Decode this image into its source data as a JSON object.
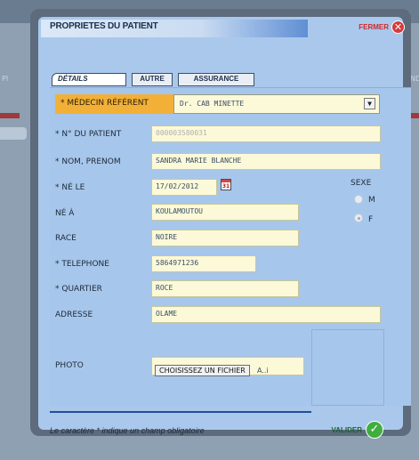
{
  "background": {
    "left_edge_text": "PI",
    "right_edge_text": "ND"
  },
  "modal": {
    "title": "PROPRIETES DU PATIENT",
    "close_label": "FERMER",
    "close_icon": "close-icon"
  },
  "tabs": [
    {
      "label": "DÉTAILS",
      "active": true
    },
    {
      "label": "AUTRE",
      "active": false
    },
    {
      "label": "ASSURANCE",
      "active": false
    }
  ],
  "form": {
    "medecin": {
      "label": "* MÉDECIN RÉFÉRENT",
      "value": "Dr. CAB MINETTE"
    },
    "numero": {
      "label": "* N° DU PATIENT",
      "value": "000003580031"
    },
    "nom": {
      "label": "* NOM, PRENOM",
      "value": "SANDRA MARIE BLANCHE"
    },
    "naissance": {
      "label": "* NÉ LE",
      "value": "17/02/2012",
      "calendar_icon_text": "31"
    },
    "lieu": {
      "label": "NÉ À",
      "value": "KOULAMOUTOU"
    },
    "race": {
      "label": "RACE",
      "value": "NOIRE"
    },
    "telephone": {
      "label": "* TELEPHONE",
      "value": "5864971236"
    },
    "quartier": {
      "label": "* QUARTIER",
      "value": "ROCE"
    },
    "adresse": {
      "label": "ADRESSE",
      "value": "OLAME"
    },
    "photo": {
      "label": "PHOTO",
      "button_label": "CHOISISSEZ UN FICHIER",
      "file_text": "A..i"
    },
    "sexe": {
      "label": "SEXE",
      "options": [
        {
          "label": "M",
          "checked": false
        },
        {
          "label": "F",
          "checked": true
        }
      ]
    }
  },
  "footer": {
    "note": "Le caractère * indique un champ obligatoire",
    "submit_label": "VALIDER"
  },
  "colors": {
    "accent_orange": "#f2b038",
    "close_red": "#d63b3b",
    "submit_green": "#3fae3f",
    "panel_blue": "#aac8ec"
  }
}
